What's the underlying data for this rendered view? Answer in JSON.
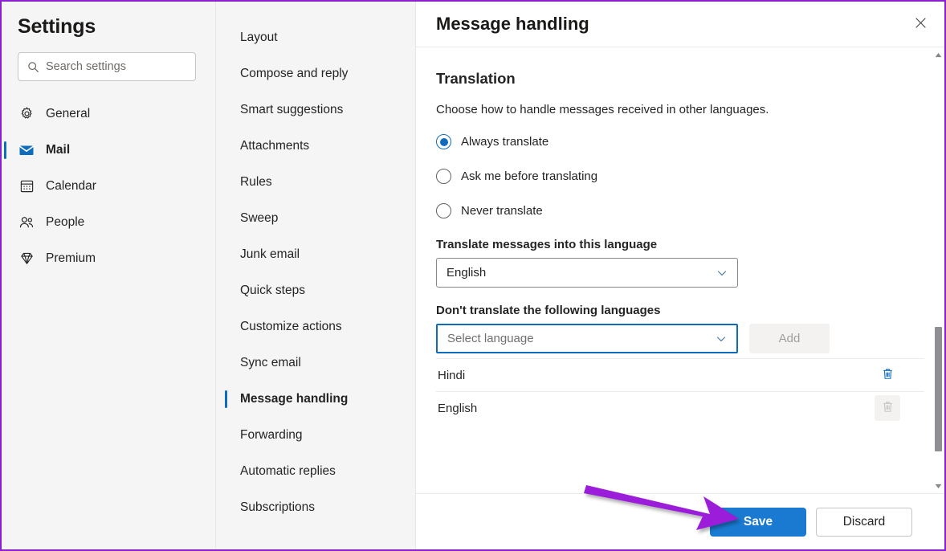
{
  "sidebar": {
    "title": "Settings",
    "search": {
      "placeholder": "Search settings",
      "value": "",
      "icon": "search-icon"
    },
    "items": [
      {
        "label": "General",
        "icon": "gear-icon",
        "selected": false
      },
      {
        "label": "Mail",
        "icon": "mail-icon",
        "selected": true
      },
      {
        "label": "Calendar",
        "icon": "calendar-icon",
        "selected": false
      },
      {
        "label": "People",
        "icon": "people-icon",
        "selected": false
      },
      {
        "label": "Premium",
        "icon": "diamond-icon",
        "selected": false
      }
    ]
  },
  "subnav": {
    "items": [
      {
        "label": "Layout",
        "selected": false
      },
      {
        "label": "Compose and reply",
        "selected": false
      },
      {
        "label": "Smart suggestions",
        "selected": false
      },
      {
        "label": "Attachments",
        "selected": false
      },
      {
        "label": "Rules",
        "selected": false
      },
      {
        "label": "Sweep",
        "selected": false
      },
      {
        "label": "Junk email",
        "selected": false
      },
      {
        "label": "Quick steps",
        "selected": false
      },
      {
        "label": "Customize actions",
        "selected": false
      },
      {
        "label": "Sync email",
        "selected": false
      },
      {
        "label": "Message handling",
        "selected": true
      },
      {
        "label": "Forwarding",
        "selected": false
      },
      {
        "label": "Automatic replies",
        "selected": false
      },
      {
        "label": "Subscriptions",
        "selected": false
      }
    ]
  },
  "main": {
    "title": "Message handling",
    "close_icon": "close-icon",
    "section": {
      "heading": "Translation",
      "description": "Choose how to handle messages received in other languages.",
      "radio_options": [
        {
          "label": "Always translate",
          "checked": true
        },
        {
          "label": "Ask me before translating",
          "checked": false
        },
        {
          "label": "Never translate",
          "checked": false
        }
      ],
      "target_language": {
        "label": "Translate messages into this language",
        "value": "English",
        "chevron_icon": "chevron-down-icon"
      },
      "excluded_languages": {
        "label": "Don't translate the following languages",
        "select_placeholder": "Select language",
        "select_value": "",
        "chevron_icon": "chevron-down-icon",
        "add_label": "Add",
        "add_disabled": true,
        "list": [
          {
            "name": "Hindi",
            "delete_icon": "trash-icon",
            "delete_disabled": false
          },
          {
            "name": "English",
            "delete_icon": "trash-icon",
            "delete_disabled": true
          }
        ]
      }
    }
  },
  "footer": {
    "save_label": "Save",
    "discard_label": "Discard"
  },
  "scrollbar": {
    "up_icon": "caret-up-icon",
    "down_icon": "caret-down-icon"
  },
  "annotation": {
    "arrow_icon": "pointer-arrow-icon",
    "color": "#9b1fd9"
  },
  "colors": {
    "accent_blue": "#0f6cbd",
    "primary_button": "#1a7ad1",
    "sidebar_bg": "#f5f5f5",
    "annotation_purple": "#9b1fd9",
    "border_frame": "#8a1fd0"
  }
}
